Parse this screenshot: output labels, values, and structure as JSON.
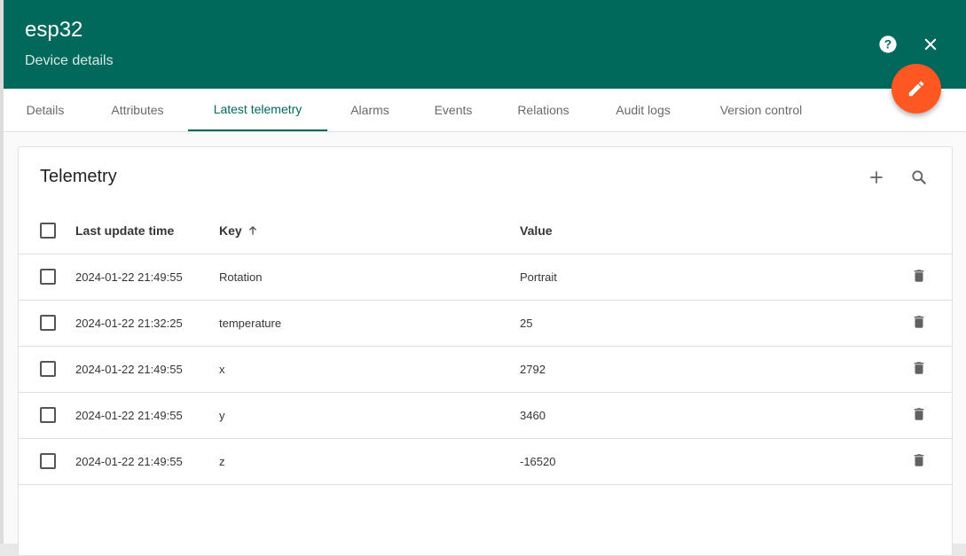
{
  "header": {
    "title": "esp32",
    "subtitle": "Device details",
    "help_icon": "help-circle-icon",
    "close_icon": "close-icon",
    "edit_icon": "pencil-icon",
    "color": "#00695c",
    "fab_color": "#ff5722"
  },
  "tabs": [
    {
      "label": "Details"
    },
    {
      "label": "Attributes"
    },
    {
      "label": "Latest telemetry",
      "active": true
    },
    {
      "label": "Alarms"
    },
    {
      "label": "Events"
    },
    {
      "label": "Relations"
    },
    {
      "label": "Audit logs"
    },
    {
      "label": "Version control"
    }
  ],
  "telemetry": {
    "title": "Telemetry",
    "add_icon": "plus-icon",
    "search_icon": "search-icon",
    "columns": {
      "last_update_time": "Last update time",
      "key": "Key",
      "key_sort_icon": "arrow-up-icon",
      "value": "Value"
    },
    "rows": [
      {
        "time": "2024-01-22 21:49:55",
        "key": "Rotation",
        "value": "Portrait"
      },
      {
        "time": "2024-01-22 21:32:25",
        "key": "temperature",
        "value": "25"
      },
      {
        "time": "2024-01-22 21:49:55",
        "key": "x",
        "value": "2792"
      },
      {
        "time": "2024-01-22 21:49:55",
        "key": "y",
        "value": "3460"
      },
      {
        "time": "2024-01-22 21:49:55",
        "key": "z",
        "value": "-16520"
      }
    ]
  }
}
